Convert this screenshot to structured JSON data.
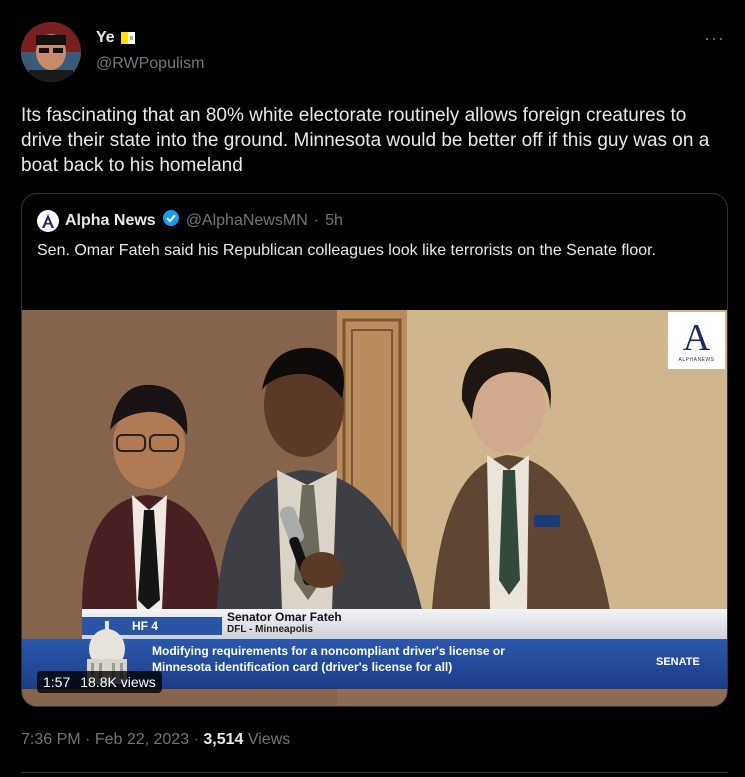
{
  "author": {
    "display_name": "Ye",
    "handle": "@RWPopulism",
    "badge_icon": "flag-icon",
    "avatar_icon": "avatar-portrait"
  },
  "more_label": "···",
  "tweet": {
    "text": "Its fascinating that an 80% white electorate routinely allows foreign creatures to drive their state into the ground. Minnesota would be better off if this guy was on a boat back to his homeland"
  },
  "quote": {
    "logo_letter": "A",
    "name": "Alpha News",
    "verified_icon": "verified-badge-icon",
    "handle": "@AlphaNewsMN",
    "separator": "·",
    "time": "5h",
    "text": "Sen. Omar Fateh said his Republican colleagues look like terrorists on the Senate floor.",
    "media": {
      "logo_letter": "A",
      "logo_text": "ALPHANEWS",
      "chyron": {
        "tag": "HF 4",
        "name": "Senator Omar Fateh",
        "subtitle": "DFL - Minneapolis",
        "line1": "Modifying requirements for a noncompliant driver's license or",
        "line2": "Minnesota identification card (driver's license for all)",
        "channel": "SENATE"
      },
      "duration": "1:57",
      "views": "18.8K views"
    }
  },
  "meta": {
    "time": "7:36 PM",
    "dot1": "·",
    "date": "Feb 22, 2023",
    "dot2": "·",
    "views_count": "3,514",
    "views_label": "Views"
  },
  "colors": {
    "background": "#000000",
    "text": "#e7e9ea",
    "muted": "#71767b",
    "verified": "#1d9bf0",
    "chyron_blue": "#2a55a5"
  }
}
